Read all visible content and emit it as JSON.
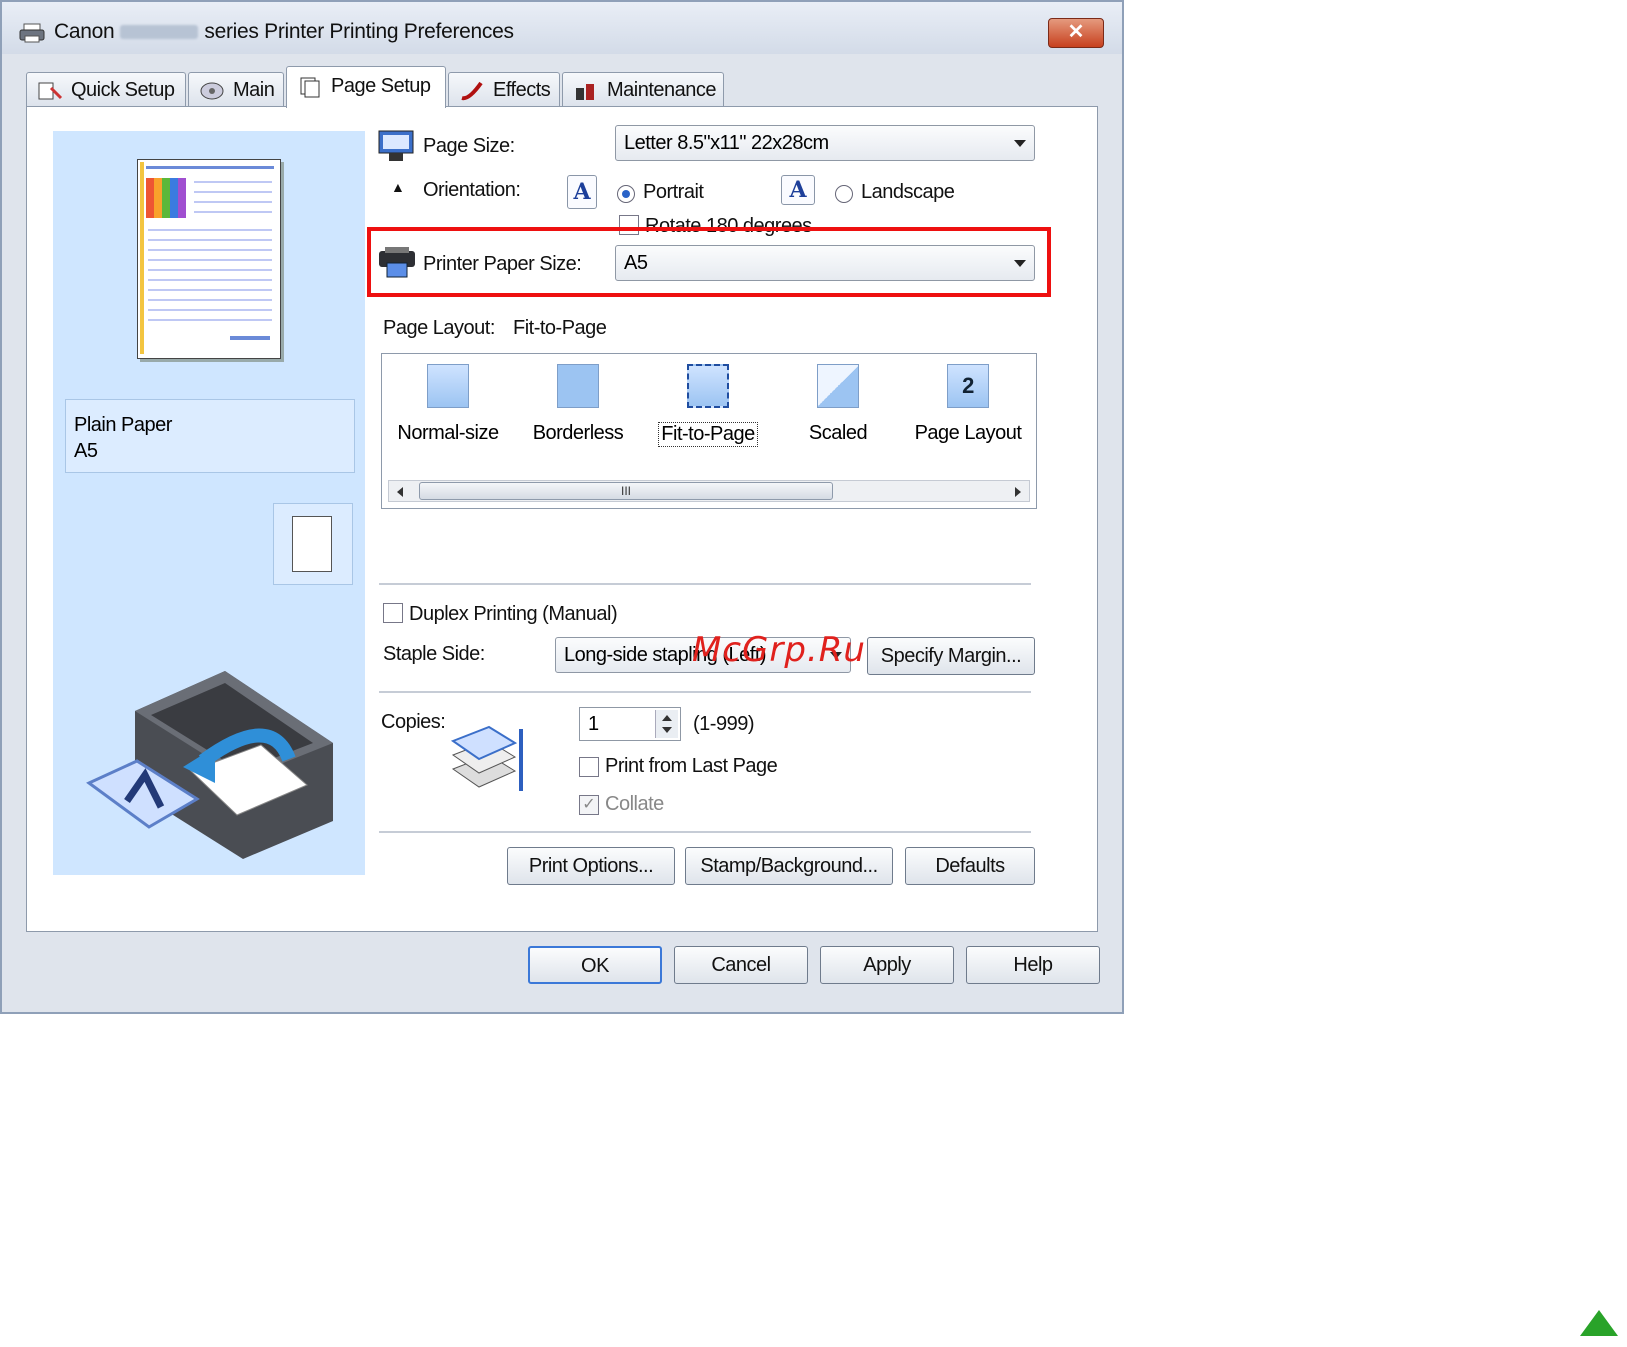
{
  "window": {
    "title_prefix": "Canon",
    "title_suffix": "series Printer Printing Preferences",
    "close_label": "✕"
  },
  "tabs": [
    {
      "label": "Quick Setup",
      "icon": "quick-setup-icon"
    },
    {
      "label": "Main",
      "icon": "main-icon"
    },
    {
      "label": "Page Setup",
      "icon": "page-setup-icon"
    },
    {
      "label": "Effects",
      "icon": "effects-icon"
    },
    {
      "label": "Maintenance",
      "icon": "maintenance-icon"
    }
  ],
  "active_tab": "Page Setup",
  "preview": {
    "media_type": "Plain Paper",
    "media_size": "A5"
  },
  "page_size": {
    "label": "Page Size:",
    "value": "Letter 8.5\"x11\" 22x28cm"
  },
  "orientation": {
    "label": "Orientation:",
    "portrait_label": "Portrait",
    "landscape_label": "Landscape",
    "selected": "Portrait",
    "icon_glyph": "A",
    "rotate_label": "Rotate 180 degrees",
    "rotate_checked": false
  },
  "printer_paper_size": {
    "label": "Printer Paper Size:",
    "value": "A5"
  },
  "page_layout": {
    "label": "Page Layout:",
    "value": "Fit-to-Page",
    "items": [
      {
        "label": "Normal-size",
        "icon": "normal-size-icon",
        "glyph": ""
      },
      {
        "label": "Borderless",
        "icon": "borderless-icon",
        "glyph": ""
      },
      {
        "label": "Fit-to-Page",
        "icon": "fit-to-page-icon",
        "glyph": ""
      },
      {
        "label": "Scaled",
        "icon": "scaled-icon",
        "glyph": ""
      },
      {
        "label": "Page Layout",
        "icon": "page-layout-icon",
        "glyph": "2"
      }
    ],
    "scroll_grip": "III"
  },
  "duplex": {
    "label": "Duplex Printing (Manual)",
    "checked": false
  },
  "staple_side": {
    "label": "Staple Side:",
    "value": "Long-side stapling (Left)",
    "specify_margin_label": "Specify Margin..."
  },
  "copies": {
    "label": "Copies:",
    "value": "1",
    "range": "(1-999)",
    "print_last_page_label": "Print from Last Page",
    "collate_label": "Collate",
    "collate_check": "✓"
  },
  "panel_buttons": {
    "print_options": "Print Options...",
    "stamp_background": "Stamp/Background...",
    "defaults": "Defaults"
  },
  "dialog_buttons": {
    "ok": "OK",
    "cancel": "Cancel",
    "apply": "Apply",
    "help": "Help"
  },
  "watermark": "McGrp.Ru",
  "colors": {
    "highlight": "#ee1010",
    "preview_bg": "#cfe6ff",
    "watermark": "#e0211d",
    "up_arrow": "#29a329"
  }
}
